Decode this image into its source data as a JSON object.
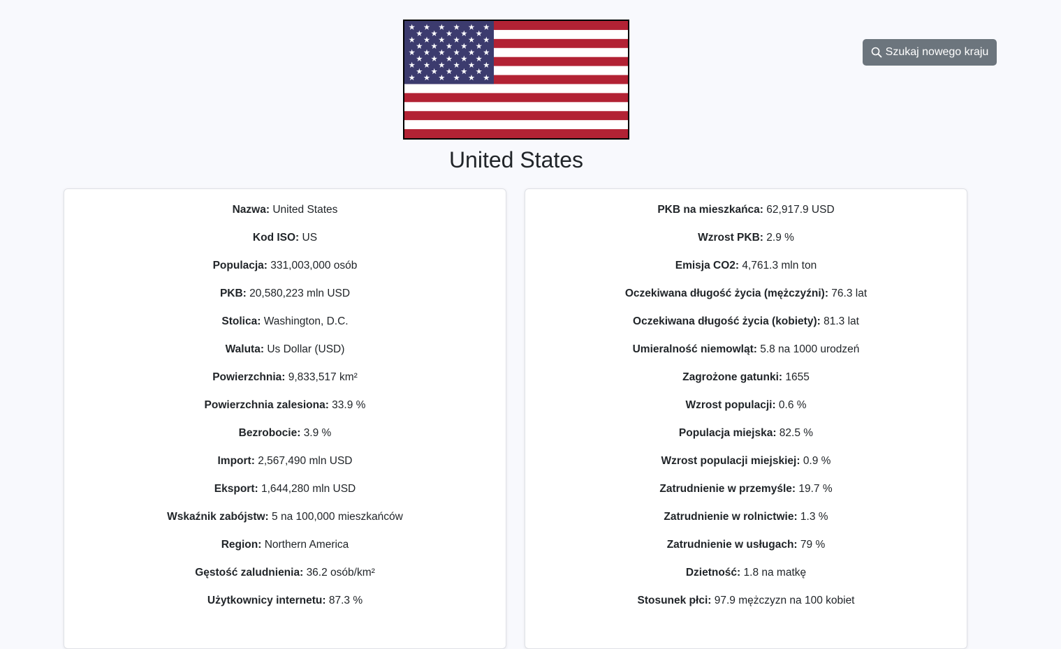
{
  "country": {
    "name": "United States"
  },
  "search_button": {
    "label": "Szukaj nowego kraju",
    "icon": "search-icon"
  },
  "flag": {
    "icon": "us-flag",
    "colors": {
      "red": "#b22234",
      "white": "#ffffff",
      "blue": "#3c3b6e"
    }
  },
  "left_card": {
    "items": [
      {
        "label": "Nazwa:",
        "value": "United States"
      },
      {
        "label": "Kod ISO:",
        "value": "US"
      },
      {
        "label": "Populacja:",
        "value": "331,003,000 osób"
      },
      {
        "label": "PKB:",
        "value": "20,580,223 mln USD"
      },
      {
        "label": "Stolica:",
        "value": "Washington, D.C."
      },
      {
        "label": "Waluta:",
        "value": "Us Dollar (USD)"
      },
      {
        "label": "Powierzchnia:",
        "value": "9,833,517 km²"
      },
      {
        "label": "Powierzchnia zalesiona:",
        "value": "33.9 %"
      },
      {
        "label": "Bezrobocie:",
        "value": "3.9 %"
      },
      {
        "label": "Import:",
        "value": "2,567,490 mln USD"
      },
      {
        "label": "Eksport:",
        "value": "1,644,280 mln USD"
      },
      {
        "label": "Wskaźnik zabójstw:",
        "value": "5 na 100,000 mieszkańców"
      },
      {
        "label": "Region:",
        "value": "Northern America"
      },
      {
        "label": "Gęstość zaludnienia:",
        "value": "36.2 osób/km²"
      },
      {
        "label": "Użytkownicy internetu:",
        "value": "87.3 %"
      }
    ]
  },
  "right_card": {
    "items": [
      {
        "label": "PKB na mieszkańca:",
        "value": "62,917.9 USD"
      },
      {
        "label": "Wzrost PKB:",
        "value": "2.9 %"
      },
      {
        "label": "Emisja CO2:",
        "value": "4,761.3 mln ton"
      },
      {
        "label": "Oczekiwana długość życia (mężczyźni):",
        "value": "76.3 lat"
      },
      {
        "label": "Oczekiwana długość życia (kobiety):",
        "value": "81.3 lat"
      },
      {
        "label": "Umieralność niemowląt:",
        "value": "5.8 na 1000 urodzeń"
      },
      {
        "label": "Zagrożone gatunki:",
        "value": "1655"
      },
      {
        "label": "Wzrost populacji:",
        "value": "0.6 %"
      },
      {
        "label": "Populacja miejska:",
        "value": "82.5 %"
      },
      {
        "label": "Wzrost populacji miejskiej:",
        "value": "0.9 %"
      },
      {
        "label": "Zatrudnienie w przemyśle:",
        "value": "19.7 %"
      },
      {
        "label": "Zatrudnienie w rolnictwie:",
        "value": "1.3 %"
      },
      {
        "label": "Zatrudnienie w usługach:",
        "value": "79 %"
      },
      {
        "label": "Dzietność:",
        "value": "1.8 na matkę"
      },
      {
        "label": "Stosunek płci:",
        "value": "97.9 mężczyzn na 100 kobiet"
      }
    ]
  }
}
